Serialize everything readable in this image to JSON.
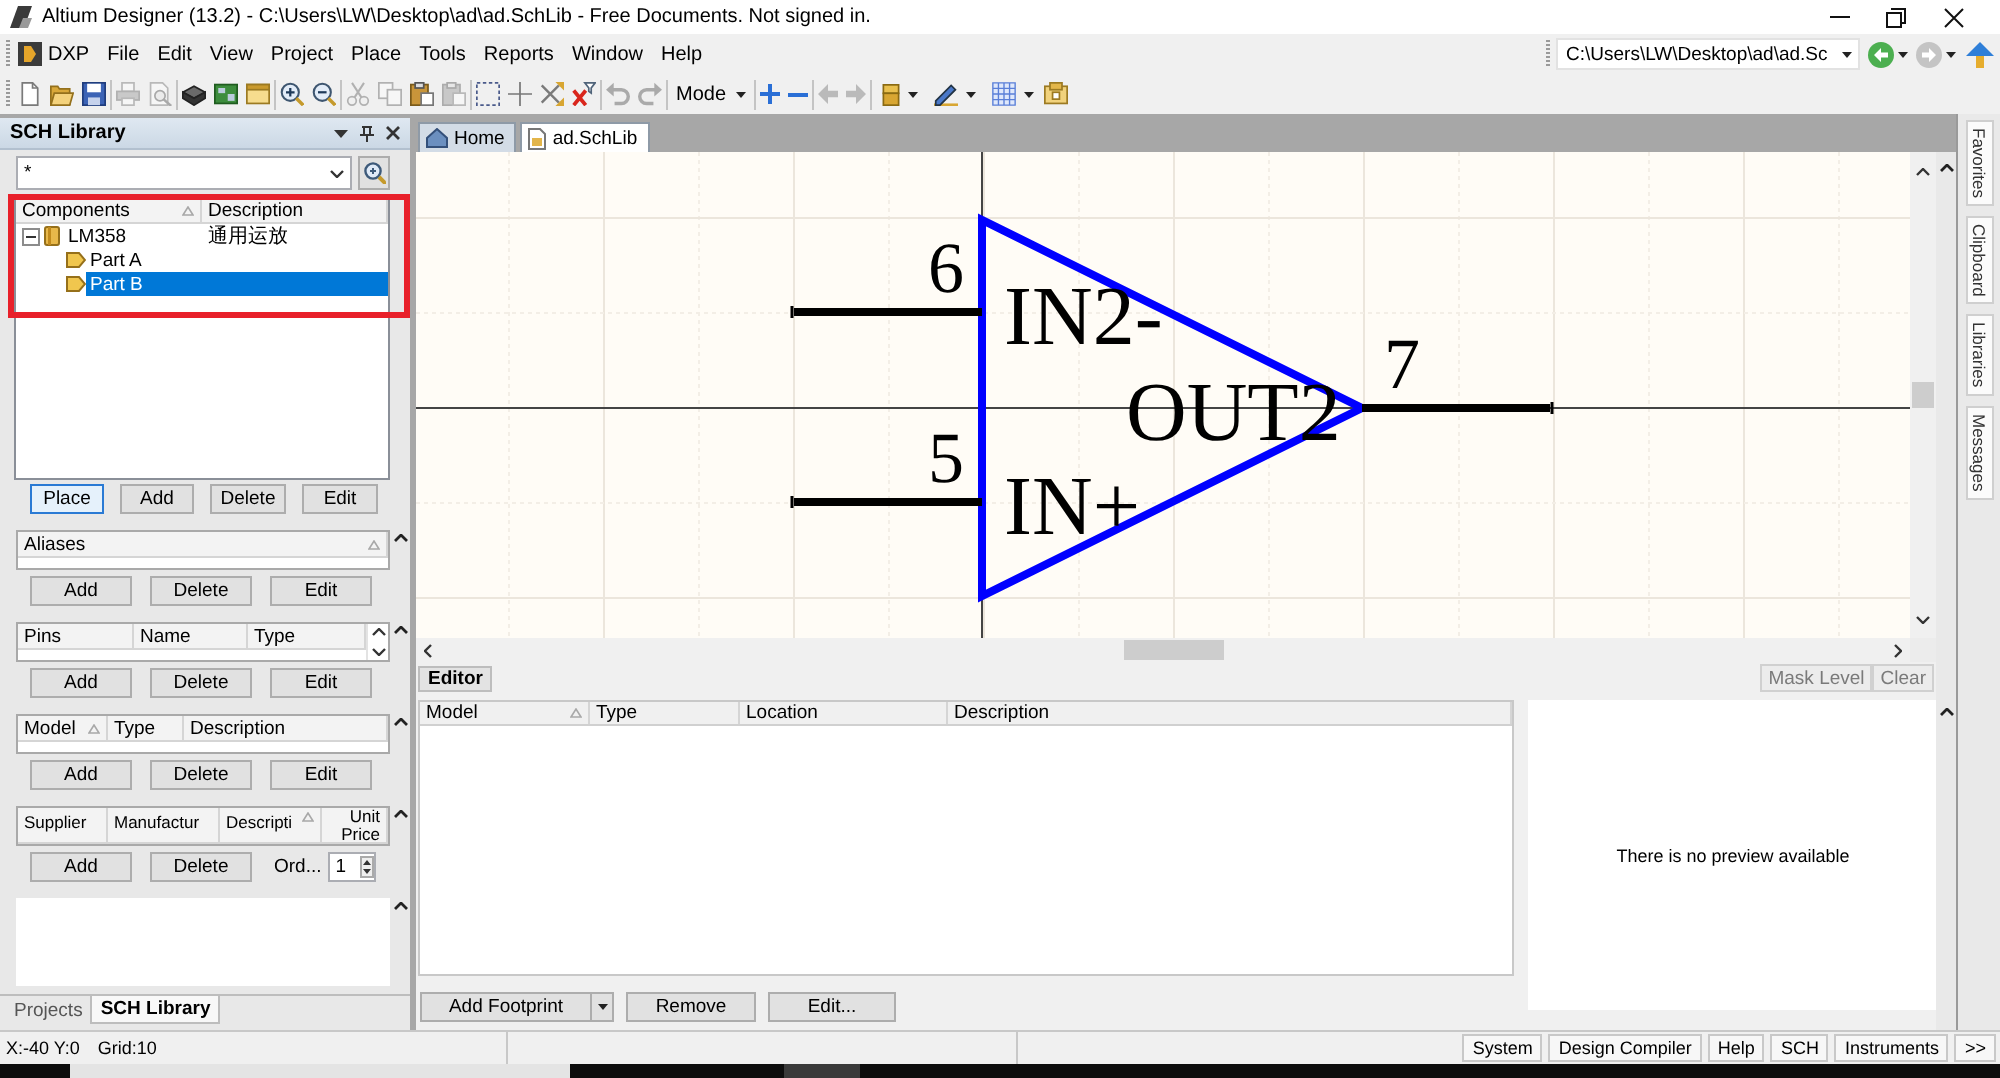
{
  "window": {
    "title": "Altium Designer (13.2) - C:\\Users\\LW\\Desktop\\ad\\ad.SchLib - Free Documents. Not signed in."
  },
  "menu": {
    "items": [
      "DXP",
      "File",
      "Edit",
      "View",
      "Project",
      "Place",
      "Tools",
      "Reports",
      "Window",
      "Help"
    ],
    "path": "C:\\Users\\LW\\Desktop\\ad\\ad.Sc",
    "navigation": [
      {
        "disabled": false
      },
      {
        "disabled": true
      }
    ]
  },
  "toolbar": {
    "items": [
      {
        "kind": "icon",
        "disabled": false
      },
      {
        "kind": "icon",
        "disabled": false
      },
      {
        "kind": "icon",
        "disabled": false
      },
      {
        "kind": "separator"
      },
      {
        "kind": "icon",
        "disabled": true
      },
      {
        "kind": "icon",
        "disabled": true
      },
      {
        "kind": "separator"
      },
      {
        "kind": "icon",
        "disabled": false
      },
      {
        "kind": "icon",
        "disabled": false
      },
      {
        "kind": "icon",
        "disabled": false
      },
      {
        "kind": "separator"
      },
      {
        "kind": "icon",
        "disabled": false
      },
      {
        "kind": "icon",
        "disabled": false
      },
      {
        "kind": "separator"
      },
      {
        "kind": "icon",
        "disabled": true
      },
      {
        "kind": "icon",
        "disabled": true
      },
      {
        "kind": "icon",
        "disabled": false
      },
      {
        "kind": "icon",
        "disabled": true
      },
      {
        "kind": "separator"
      },
      {
        "kind": "icon",
        "disabled": false
      },
      {
        "kind": "icon",
        "disabled": false
      },
      {
        "kind": "icon",
        "disabled": false
      },
      {
        "kind": "icon",
        "disabled": false
      },
      {
        "kind": "separator"
      },
      {
        "kind": "icon",
        "disabled": true
      },
      {
        "kind": "icon",
        "disabled": true
      },
      {
        "kind": "separator"
      },
      {
        "kind": "dropdown",
        "label": "Mode"
      },
      {
        "kind": "separator"
      },
      {
        "kind": "icon",
        "disabled": false
      },
      {
        "kind": "icon",
        "disabled": false
      },
      {
        "kind": "separator"
      },
      {
        "kind": "icon",
        "disabled": true
      },
      {
        "kind": "icon",
        "disabled": true
      },
      {
        "kind": "separator"
      },
      {
        "kind": "menu_icon",
        "disabled": false
      },
      {
        "kind": "menu_icon",
        "disabled": false
      },
      {
        "kind": "menu_icon",
        "disabled": false
      },
      {
        "kind": "icon",
        "disabled": false
      }
    ]
  },
  "sch_library": {
    "title": "SCH Library",
    "filter": "*",
    "components": {
      "columns": [
        {
          "label": "Components",
          "sorted": true
        },
        {
          "label": "Description",
          "sorted": false
        }
      ],
      "rows": [
        {
          "name": "LM358",
          "description": "通用运放",
          "expanded": true,
          "selected": false,
          "children": [
            {
              "name": "Part A",
              "selected": false
            },
            {
              "name": "Part B",
              "selected": true
            }
          ]
        }
      ],
      "buttons": [
        {
          "label": "Place",
          "default": true
        },
        {
          "label": "Add",
          "default": false
        },
        {
          "label": "Delete",
          "default": false
        },
        {
          "label": "Edit",
          "default": false
        }
      ]
    },
    "aliases": {
      "columns": [
        {
          "label": "Aliases",
          "sorted": true
        }
      ],
      "buttons": [
        "Add",
        "Delete",
        "Edit"
      ]
    },
    "pins": {
      "columns": [
        {
          "label": "Pins",
          "sorted": false
        },
        {
          "label": "Name",
          "sorted": false
        },
        {
          "label": "Type",
          "sorted": false
        }
      ],
      "buttons": [
        "Add",
        "Delete",
        "Edit"
      ]
    },
    "models": {
      "columns": [
        {
          "label": "Model",
          "sorted": true
        },
        {
          "label": "Type",
          "sorted": false
        },
        {
          "label": "Description",
          "sorted": false
        }
      ],
      "buttons": [
        "Add",
        "Delete",
        "Edit"
      ]
    },
    "suppliers": {
      "columns": [
        {
          "label": "Supplier",
          "sorted": false
        },
        {
          "label": "Manufactur",
          "sorted": false
        },
        {
          "label": "Descripti",
          "sorted": true
        },
        {
          "label": "Unit Price",
          "sorted": false
        }
      ],
      "buttons": [
        "Add",
        "Delete"
      ],
      "order_label": "Ord...",
      "order_quantity": "1"
    },
    "tabs": [
      {
        "label": "Projects",
        "selected": false
      },
      {
        "label": "SCH Library",
        "selected": true
      }
    ]
  },
  "documents": {
    "tabs": [
      {
        "label": "Home",
        "kind": "home",
        "selected": false
      },
      {
        "label": "ad.SchLib",
        "kind": "document",
        "selected": true
      }
    ]
  },
  "schematic": {
    "pins": [
      {
        "number": "6",
        "name": "IN2-"
      },
      {
        "number": "5",
        "name": "IN+"
      },
      {
        "number": "7",
        "name": "OUT2"
      }
    ]
  },
  "editor": {
    "tabs": [
      {
        "label": "Editor",
        "selected": true
      }
    ],
    "buttons": [
      {
        "label": "Mask Level",
        "disabled": true
      },
      {
        "label": "Clear",
        "disabled": true
      }
    ],
    "columns": [
      {
        "label": "Model",
        "sorted": true
      },
      {
        "label": "Type",
        "sorted": false
      },
      {
        "label": "Location",
        "sorted": false
      },
      {
        "label": "Description",
        "sorted": false
      }
    ],
    "preview": "There is no preview available",
    "actions": [
      {
        "label": "Add Footprint",
        "kind": "split"
      },
      {
        "label": "Remove",
        "kind": "plain"
      },
      {
        "label": "Edit...",
        "kind": "plain"
      }
    ]
  },
  "side_tabs": [
    "Favorites",
    "Clipboard",
    "Libraries",
    "Messages"
  ],
  "status_bar": {
    "coordinates": "X:-40 Y:0",
    "grid": "Grid:10",
    "buttons": [
      "System",
      "Design Compiler",
      "Help",
      "SCH",
      "Instruments",
      ">>"
    ]
  }
}
